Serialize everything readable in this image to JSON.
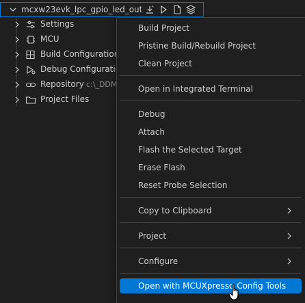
{
  "tree": {
    "root": {
      "label": "mcxw23evk_lpc_gpio_led_out...",
      "actions": [
        "debug-icon",
        "run-icon",
        "file-icon",
        "layers-icon"
      ]
    },
    "items": [
      {
        "label": "Settings",
        "icon": "settings-icon",
        "desc": ""
      },
      {
        "label": "MCU",
        "icon": "chip-icon",
        "desc": ""
      },
      {
        "label": "Build Configurations",
        "icon": "build-config-icon",
        "desc": ""
      },
      {
        "label": "Debug Configurations",
        "icon": "debug-config-icon",
        "desc": ""
      },
      {
        "label": "Repository",
        "icon": "link-icon",
        "desc": "c:\\_DDM"
      },
      {
        "label": "Project Files",
        "icon": "folder-icon",
        "desc": ""
      }
    ]
  },
  "menu": {
    "groups": [
      [
        "Build Project",
        "Pristine Build/Rebuild Project",
        "Clean Project"
      ],
      [
        "Open in Integrated Terminal"
      ],
      [
        "Debug",
        "Attach",
        "Flash the Selected Target",
        "Erase Flash",
        "Reset Probe Selection"
      ],
      [
        "Copy to Clipboard"
      ],
      [
        "Project"
      ],
      [
        "Configure"
      ],
      [
        "Open with MCUXpresso Config Tools"
      ]
    ],
    "labels": {
      "build_project": "Build Project",
      "pristine_build": "Pristine Build/Rebuild Project",
      "clean_project": "Clean Project",
      "open_terminal": "Open in Integrated Terminal",
      "debug": "Debug",
      "attach": "Attach",
      "flash_target": "Flash the Selected Target",
      "erase_flash": "Erase Flash",
      "reset_probe": "Reset Probe Selection",
      "copy_clipboard": "Copy to Clipboard",
      "project": "Project",
      "configure": "Configure",
      "open_config_tools": "Open with MCUXpresso Config Tools"
    },
    "active": "Open with MCUXpresso Config Tools"
  },
  "colors": {
    "background": "#1f1f1f",
    "accent": "#0078d4",
    "text": "#cccccc",
    "separator": "#454545"
  }
}
